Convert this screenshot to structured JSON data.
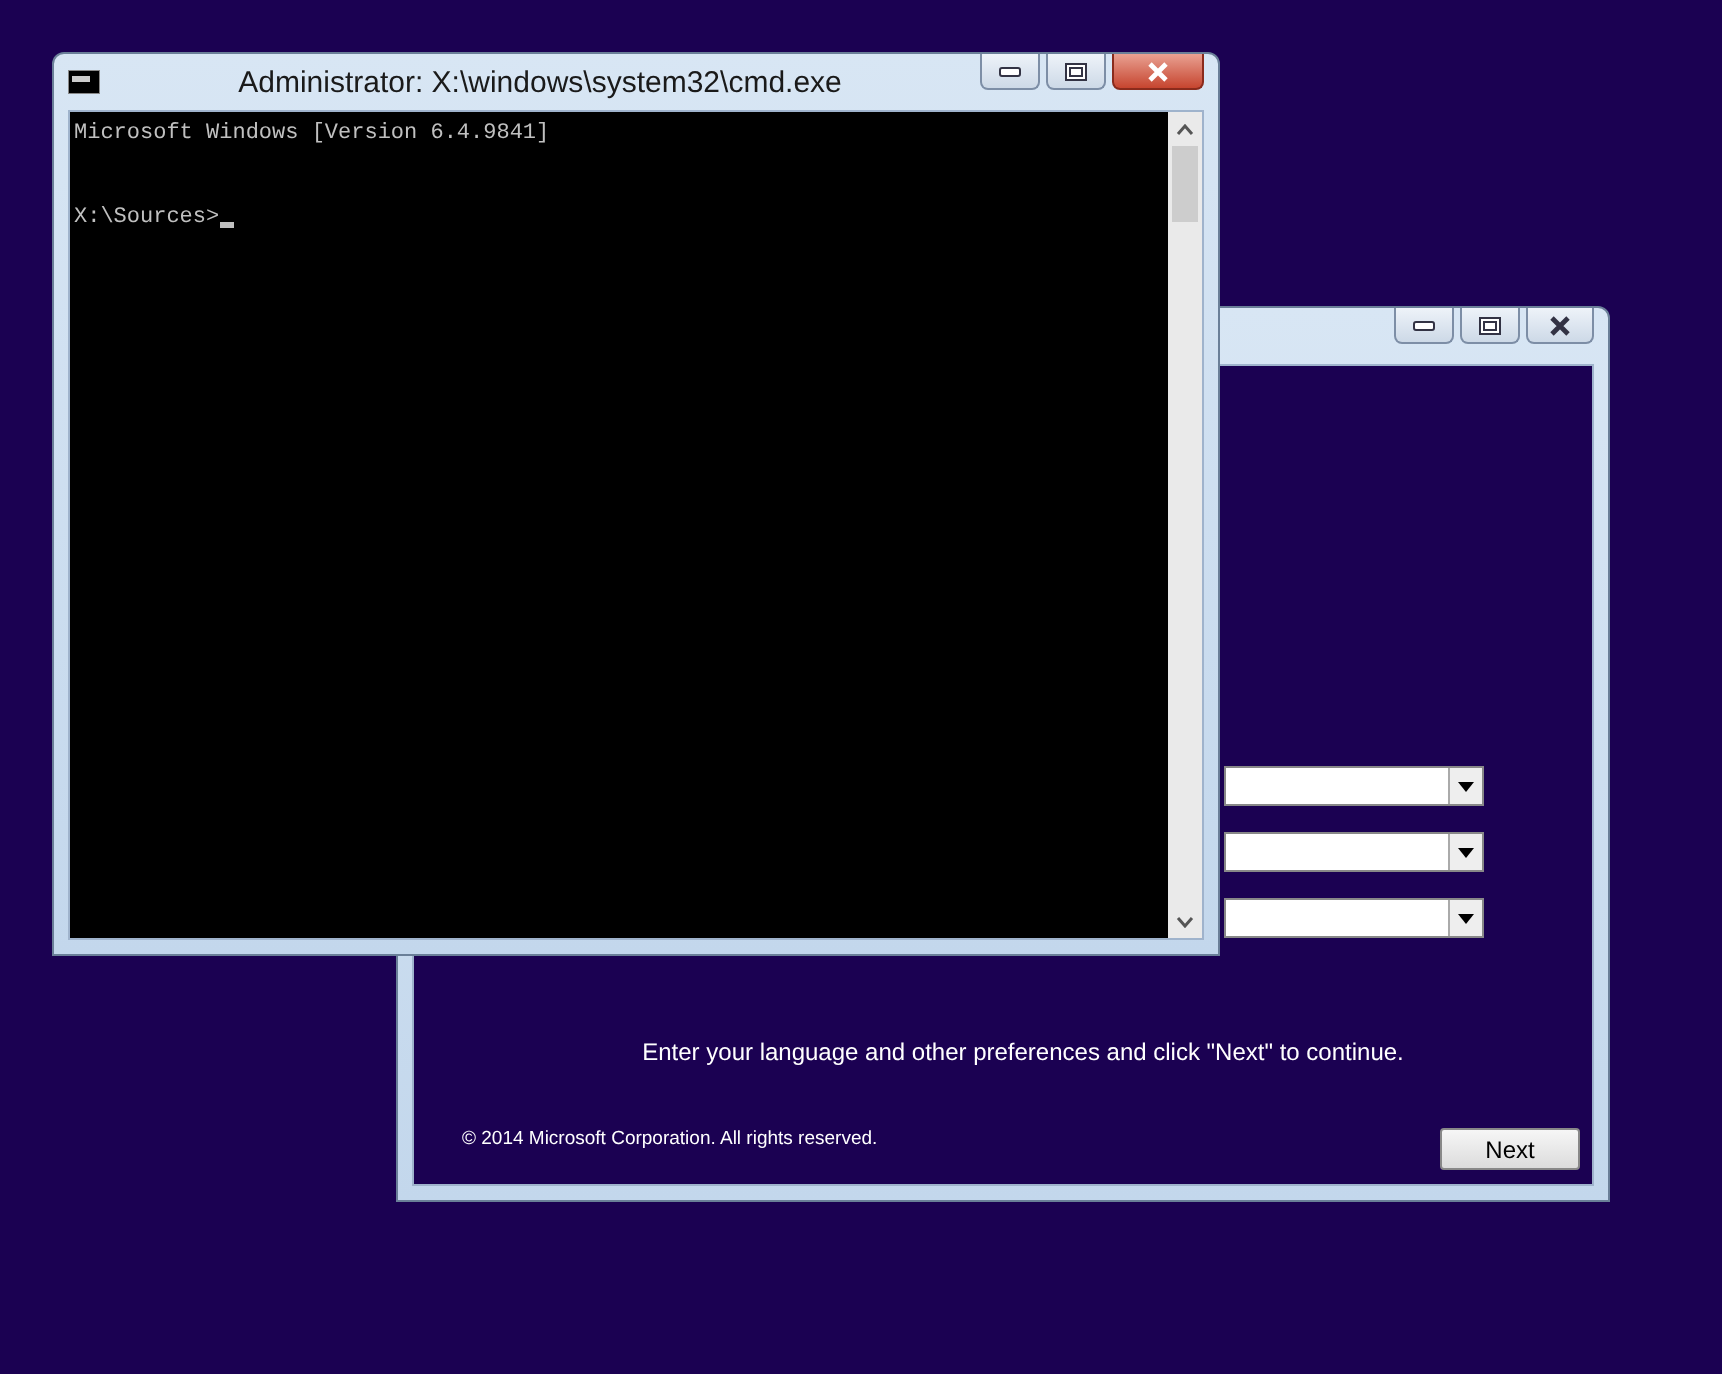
{
  "cmd_window": {
    "title": "Administrator: X:\\windows\\system32\\cmd.exe",
    "output_lines": [
      "Microsoft Windows [Version 6.4.9841]"
    ],
    "prompt": "X:\\Sources>"
  },
  "setup_window": {
    "fields": [
      {
        "kind": "dropdown"
      },
      {
        "kind": "dropdown"
      },
      {
        "kind": "dropdown"
      }
    ],
    "message": "Enter your language and other preferences and click \"Next\" to continue.",
    "copyright": "© 2014 Microsoft Corporation. All rights reserved.",
    "next_button": "Next"
  }
}
